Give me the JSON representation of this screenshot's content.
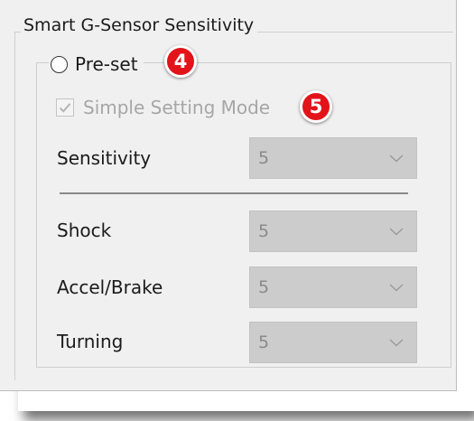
{
  "group_title": "Smart G-Sensor Sensitivity",
  "preset": {
    "label": "Pre-set",
    "selected": false,
    "badge": "4"
  },
  "simple_mode": {
    "label": "Simple Setting Mode",
    "checked": true,
    "enabled": false,
    "badge": "5"
  },
  "fields": {
    "sensitivity": {
      "label": "Sensitivity",
      "value": "5"
    },
    "shock": {
      "label": "Shock",
      "value": "5"
    },
    "accel_brake": {
      "label": "Accel/Brake",
      "value": "5"
    },
    "turning": {
      "label": "Turning",
      "value": "5"
    }
  },
  "colors": {
    "badge": "#e2141a",
    "disabled_text": "#a6a6a6",
    "panel_bg": "#f0f0f0"
  }
}
